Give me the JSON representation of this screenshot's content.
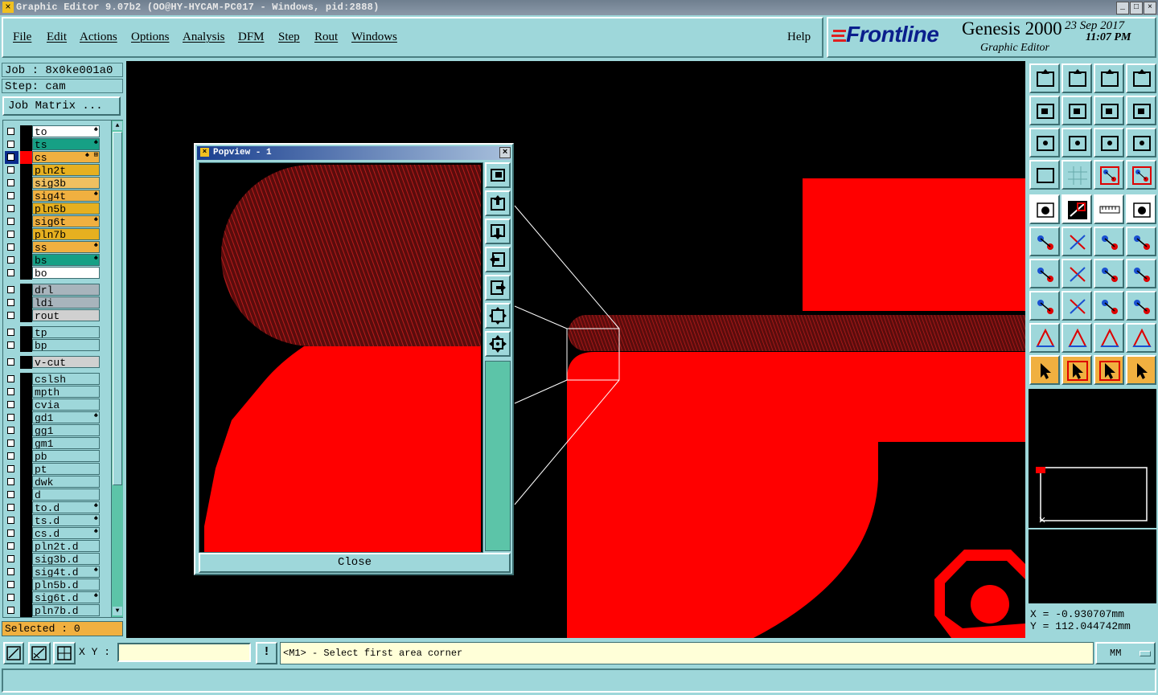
{
  "window": {
    "title": "Graphic Editor 9.07b2 (OO@HY-HYCAM-PC017 - Windows, pid:2888)",
    "buttons": [
      "_",
      "□",
      "×"
    ]
  },
  "menubar": {
    "items": [
      "File",
      "Edit",
      "Actions",
      "Options",
      "Analysis",
      "DFM",
      "Step",
      "Rout",
      "Windows"
    ],
    "help": "Help"
  },
  "brand": {
    "logo": "Frontline",
    "product": "Genesis 2000",
    "subtitle": "Graphic Editor",
    "date": "23 Sep 2017",
    "time": "11:07 PM"
  },
  "job": {
    "job_label": "Job : 8x0ke001a0",
    "step_label": "Step: cam",
    "matrix_button": "Job Matrix ..."
  },
  "layers": [
    {
      "name": "to",
      "color": "#ffffff",
      "mark": "♠"
    },
    {
      "name": "ts",
      "color": "#16a085",
      "mark": "♠"
    },
    {
      "name": "cs",
      "color": "#f0b040",
      "mark": "♠ ⊞",
      "active": true
    },
    {
      "name": "pln2t",
      "color": "#e6b020",
      "mark": ""
    },
    {
      "name": "sig3b",
      "color": "#f0c060",
      "mark": ""
    },
    {
      "name": "sig4t",
      "color": "#f0b040",
      "mark": "♠"
    },
    {
      "name": "pln5b",
      "color": "#e6b020",
      "mark": ""
    },
    {
      "name": "sig6t",
      "color": "#f0b040",
      "mark": "♠"
    },
    {
      "name": "pln7b",
      "color": "#e6b020",
      "mark": ""
    },
    {
      "name": "ss",
      "color": "#f0b040",
      "mark": "♠"
    },
    {
      "name": "bs",
      "color": "#16a085",
      "mark": "♠"
    },
    {
      "name": "bo",
      "color": "#ffffff",
      "mark": ""
    },
    {
      "name": "drl",
      "color": "#a8b4bc",
      "mark": ""
    },
    {
      "name": "ldi",
      "color": "#a8b4bc",
      "mark": ""
    },
    {
      "name": "rout",
      "color": "#d0d0d0",
      "mark": ""
    },
    {
      "name": "tp",
      "color": "#9ed7da",
      "mark": ""
    },
    {
      "name": "bp",
      "color": "#9ed7da",
      "mark": ""
    },
    {
      "name": "v-cut",
      "color": "#d0d0d0",
      "mark": ""
    },
    {
      "name": "cslsh",
      "color": "#9ed7da",
      "mark": ""
    },
    {
      "name": "mpth",
      "color": "#9ed7da",
      "mark": ""
    },
    {
      "name": "cvia",
      "color": "#9ed7da",
      "mark": ""
    },
    {
      "name": "gd1",
      "color": "#9ed7da",
      "mark": "♠"
    },
    {
      "name": "gg1",
      "color": "#9ed7da",
      "mark": ""
    },
    {
      "name": "gm1",
      "color": "#9ed7da",
      "mark": ""
    },
    {
      "name": "pb",
      "color": "#9ed7da",
      "mark": ""
    },
    {
      "name": "pt",
      "color": "#9ed7da",
      "mark": ""
    },
    {
      "name": "dwk",
      "color": "#9ed7da",
      "mark": ""
    },
    {
      "name": "d",
      "color": "#9ed7da",
      "mark": ""
    },
    {
      "name": "to.d",
      "color": "#9ed7da",
      "mark": "♠"
    },
    {
      "name": "ts.d",
      "color": "#9ed7da",
      "mark": "♠"
    },
    {
      "name": "cs.d",
      "color": "#9ed7da",
      "mark": "♠"
    },
    {
      "name": "pln2t.d",
      "color": "#9ed7da",
      "mark": ""
    },
    {
      "name": "sig3b.d",
      "color": "#9ed7da",
      "mark": ""
    },
    {
      "name": "sig4t.d",
      "color": "#9ed7da",
      "mark": "♠"
    },
    {
      "name": "pln5b.d",
      "color": "#9ed7da",
      "mark": ""
    },
    {
      "name": "sig6t.d",
      "color": "#9ed7da",
      "mark": "♠"
    },
    {
      "name": "pln7b.d",
      "color": "#9ed7da",
      "mark": ""
    }
  ],
  "selected": "Selected : 0",
  "popview": {
    "title": "Popview - 1",
    "close_button": "Close"
  },
  "coords": {
    "x": "X = -0.930707mm",
    "y": "Y = 112.044742mm"
  },
  "bottom": {
    "xy_label": "X Y :",
    "xy_value": "",
    "prompt": "<M1> - Select first area corner",
    "units": "MM"
  },
  "colors": {
    "panel": "#9ed7da",
    "copper": "#ff0000",
    "canvas_bg": "#000000",
    "highlight": "#f0b040"
  }
}
